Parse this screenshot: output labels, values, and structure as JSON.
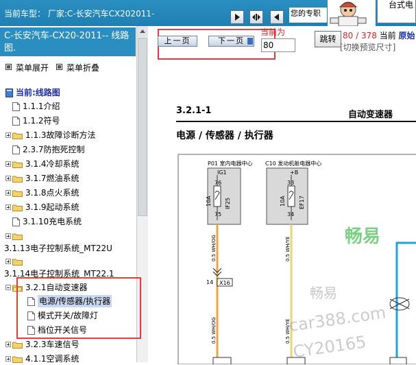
{
  "topbar": {
    "model_label": "当前车型：  厂家:C-长安汽车CX202011-",
    "help_text": "您的专职",
    "brand_text": "台式电"
  },
  "sidebar": {
    "doc_title": "C-长安汽车-CX20-2011-- 线路图.",
    "expand_all": "菜单展开",
    "collapse_all": "菜单折叠",
    "tree": {
      "root": "当前:线路图",
      "items": [
        {
          "label": "1.1.1介绍"
        },
        {
          "label": "1.1.2符号"
        },
        {
          "label": "1.1.3故障诊断方法"
        },
        {
          "label": "2.3.7防抱死控制"
        },
        {
          "label": "3.1.4冷却系统"
        },
        {
          "label": "3.1.7燃油系统"
        },
        {
          "label": "3.1.8点火系统"
        },
        {
          "label": "3.1.9起动系统"
        },
        {
          "label": "3.1.10充电系统"
        },
        {
          "label": "3.1.13电子控制系统_MT22U"
        },
        {
          "label": "3.1.14电子控制系统_MT22.1"
        },
        {
          "label": "3.2.1自动变速器"
        },
        {
          "label": "电源/传感器/执行器"
        },
        {
          "label": "模式开关/故障灯"
        },
        {
          "label": "档位开关信号"
        },
        {
          "label": "3.2.3车速信号"
        },
        {
          "label": "4.1.1空调系统"
        }
      ]
    }
  },
  "main": {
    "prev_page": "上一页",
    "next_page": "下一页",
    "current_page_label": "当前为",
    "page_input_value": "80",
    "jump_button": "跳转",
    "page_current": "80",
    "page_total": "378",
    "current_label": "当前",
    "original_label": "原始",
    "preview_size": "[切换预览尺寸]",
    "doc": {
      "section": "3.2.1-1",
      "header": "自动变速器",
      "subtitle": "电源 / 传感器 / 执行器",
      "box1_label": "P01 室内电器中心",
      "box1_ig": "IG1",
      "box1_top_pin": "76",
      "box1_fuse_amp": "10A",
      "box1_fuse_name": "IF25",
      "box1_bottom_pin": "75",
      "box2_label": "C10 发动机舱电器中心",
      "box2_b": "+B",
      "box2_top_pin": "33",
      "box2_fuse_amp": "10A",
      "box2_fuse_name": "EF17",
      "box2_bottom_pin": "34",
      "wire1": "0.5 WH/OG",
      "wire1b": "0.5 WH/OG",
      "wire2": "0.5 WH/YE",
      "wire2b": "0.5 WH/YE",
      "connector_pin": "14",
      "connector_name": "X16",
      "watermark1": "畅易",
      "watermark2": "畅易",
      "watermark3": "car388.com",
      "watermark4": "CY20165"
    }
  }
}
